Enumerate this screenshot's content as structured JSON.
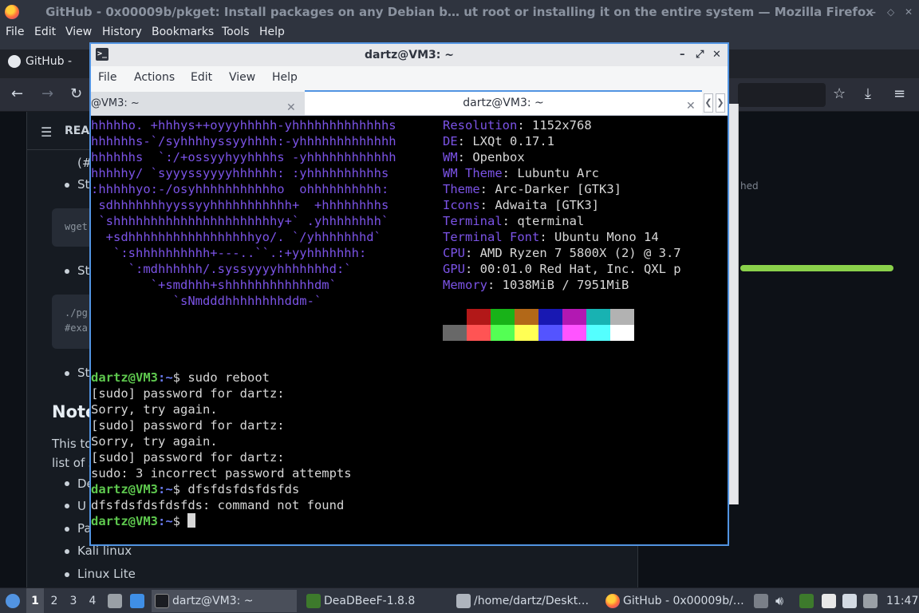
{
  "firefox": {
    "title": "GitHub - 0x00009b/pkget: Install packages on any Debian b… ut root or installing it on the entire system — Mozilla Firefox",
    "menu": [
      "File",
      "Edit",
      "View",
      "History",
      "Bookmarks",
      "Tools",
      "Help"
    ],
    "tab_label": "GitHub - fsq",
    "page": {
      "readme_label": "REA",
      "fragment_1": "(#",
      "bullet_1": "St",
      "code_1": "wget",
      "bullet_2": "St",
      "code_2_line1": "./pg",
      "code_2_line2": "#exa",
      "bullet_3": "St",
      "heading": "Note",
      "para_line1": "This to",
      "para_line2": "list of s",
      "list": [
        "De",
        "U",
        "Pa",
        "Kali linux",
        "Linux Lite"
      ],
      "right_text": "hed"
    }
  },
  "terminal": {
    "title": "dartz@VM3: ~",
    "menu": [
      "File",
      "Actions",
      "Edit",
      "View",
      "Help"
    ],
    "tabs": [
      {
        "label": "@VM3: ~"
      },
      {
        "label": "dartz@VM3: ~"
      }
    ],
    "ascii_art": [
      "hhhhho. +hhhys++oyyyhhhhh-yhhhhhhhhhhhhhs",
      "hhhhhhs-`/syhhhhyssyyhhhh:-yhhhhhhhhhhhhh",
      "hhhhhhs  `:/+ossyyhyyhhhhs -yhhhhhhhhhhhh",
      "hhhhhy/ `syyyssyyyyhhhhhh: :yhhhhhhhhhhs",
      ":hhhhhyo:-/osyhhhhhhhhhhho  ohhhhhhhhhh:",
      " sdhhhhhhhyyssyyhhhhhhhhhhh+  +hhhhhhhhs",
      " `shhhhhhhhhhhhhhhhhhhhhhy+` .yhhhhhhhh`",
      "  +sdhhhhhhhhhhhhhhhhhyo/. `/yhhhhhhhd`",
      "   `:shhhhhhhhhh+---..``.:+yyhhhhhhh:",
      "     `:mdhhhhhh/.syssyyyyhhhhhhhd:`",
      "        `+smdhhh+shhhhhhhhhhhhdm`",
      "           `sNmdddhhhhhhhhddm-`"
    ],
    "info": [
      {
        "key": "Resolution",
        "value": "1152x768"
      },
      {
        "key": "DE",
        "value": "LXQt 0.17.1"
      },
      {
        "key": "WM",
        "value": "Openbox"
      },
      {
        "key": "WM Theme",
        "value": "Lubuntu Arc"
      },
      {
        "key": "Theme",
        "value": "Arc-Darker [GTK3]"
      },
      {
        "key": "Icons",
        "value": "Adwaita [GTK3]"
      },
      {
        "key": "Terminal",
        "value": "qterminal"
      },
      {
        "key": "Terminal Font",
        "value": "Ubuntu Mono 14"
      },
      {
        "key": "CPU",
        "value": "AMD Ryzen 7 5800X (2) @ 3.7"
      },
      {
        "key": "GPU",
        "value": "00:01.0 Red Hat, Inc. QXL p"
      },
      {
        "key": "Memory",
        "value": "1038MiB / 7951MiB"
      }
    ],
    "palette_row1": [
      "#000000",
      "#b21818",
      "#18b218",
      "#b26818",
      "#1818b2",
      "#b218b2",
      "#18b2b2",
      "#b2b2b2"
    ],
    "palette_row2": [
      "#686868",
      "#ff5454",
      "#54ff54",
      "#ffff54",
      "#5454ff",
      "#ff54ff",
      "#54ffff",
      "#ffffff"
    ],
    "prompt_user": "dartz@VM3",
    "prompt_path": ":~",
    "prompt_symbol": "$ ",
    "lines": [
      {
        "type": "prompt",
        "text": "sudo reboot"
      },
      {
        "type": "out",
        "text": "[sudo] password for dartz:"
      },
      {
        "type": "out",
        "text": "Sorry, try again."
      },
      {
        "type": "out",
        "text": "[sudo] password for dartz:"
      },
      {
        "type": "out",
        "text": "Sorry, try again."
      },
      {
        "type": "out",
        "text": "[sudo] password for dartz:"
      },
      {
        "type": "out",
        "text": "sudo: 3 incorrect password attempts"
      },
      {
        "type": "prompt",
        "text": "dfsfdsfdsfdsfds"
      },
      {
        "type": "out",
        "text": "dfsfdsfdsfdsfds: command not found"
      },
      {
        "type": "prompt",
        "text": ""
      }
    ]
  },
  "taskbar": {
    "workspaces": [
      "1",
      "2",
      "3",
      "4"
    ],
    "tasks": [
      {
        "label": "dartz@VM3: ~"
      },
      {
        "label": "DeaDBeeF-1.8.8"
      },
      {
        "label": "/home/dartz/Deskt…"
      },
      {
        "label": "GitHub - 0x00009b/…"
      }
    ],
    "clock": "11:47"
  }
}
